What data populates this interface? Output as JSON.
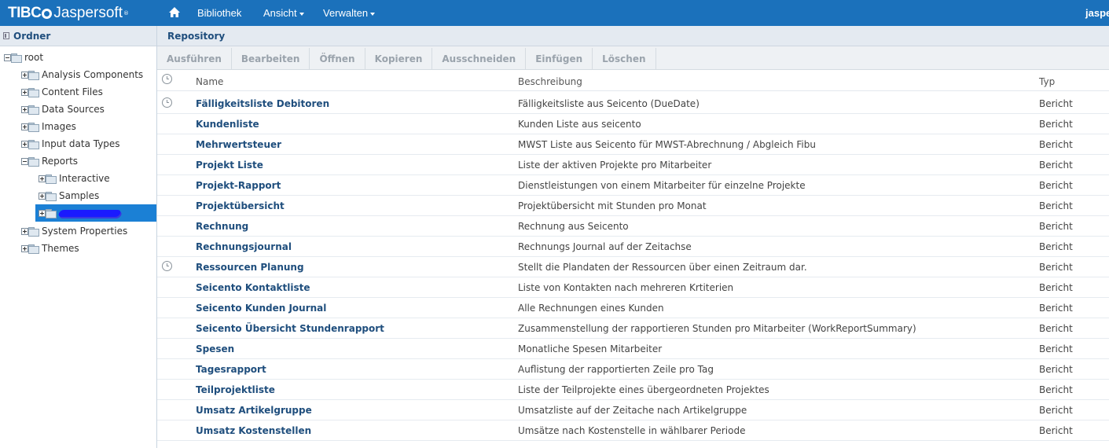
{
  "topbar": {
    "logo_brand": "TIBC",
    "logo_product": "Jaspersoft",
    "nav": [
      {
        "label": "Bibliothek",
        "dropdown": false
      },
      {
        "label": "Ansicht",
        "dropdown": true
      },
      {
        "label": "Verwalten",
        "dropdown": true
      }
    ],
    "user": "jaspe"
  },
  "left_panel": {
    "title": "Ordner",
    "tree": [
      {
        "label": "root",
        "expanded": true
      },
      {
        "label": "Analysis Components",
        "expanded": false
      },
      {
        "label": "Content Files",
        "expanded": false
      },
      {
        "label": "Data Sources",
        "expanded": false
      },
      {
        "label": "Images",
        "expanded": false
      },
      {
        "label": "Input data Types",
        "expanded": false
      },
      {
        "label": "Reports",
        "expanded": true
      },
      {
        "label": "Interactive",
        "expanded": false
      },
      {
        "label": "Samples",
        "expanded": false
      },
      {
        "label": "",
        "expanded": false,
        "selected": true,
        "redacted": true
      },
      {
        "label": "System Properties",
        "expanded": false
      },
      {
        "label": "Themes",
        "expanded": false
      }
    ]
  },
  "main": {
    "title": "Repository",
    "toolbar": [
      "Ausführen",
      "Bearbeiten",
      "Öffnen",
      "Kopieren",
      "Ausschneiden",
      "Einfügen",
      "Löschen"
    ],
    "columns": {
      "name": "Name",
      "description": "Beschreibung",
      "type": "Typ"
    },
    "rows": [
      {
        "name": "Fälligkeitsliste Debitoren",
        "description": "Fälligkeitsliste aus Seicento (DueDate)",
        "type": "Bericht",
        "scheduled": true
      },
      {
        "name": "Kundenliste",
        "description": "Kunden Liste aus seicento",
        "type": "Bericht",
        "scheduled": false
      },
      {
        "name": "Mehrwertsteuer",
        "description": "MWST Liste aus Seicento für MWST-Abrechnung / Abgleich Fibu",
        "type": "Bericht",
        "scheduled": false
      },
      {
        "name": "Projekt Liste",
        "description": "Liste der aktiven Projekte pro Mitarbeiter",
        "type": "Bericht",
        "scheduled": false
      },
      {
        "name": "Projekt-Rapport",
        "description": "Dienstleistungen von einem Mitarbeiter für einzelne Projekte",
        "type": "Bericht",
        "scheduled": false
      },
      {
        "name": "Projektübersicht",
        "description": "Projektübersicht mit Stunden pro Monat",
        "type": "Bericht",
        "scheduled": false
      },
      {
        "name": "Rechnung",
        "description": "Rechnung aus Seicento",
        "type": "Bericht",
        "scheduled": false
      },
      {
        "name": "Rechnungsjournal",
        "description": "Rechnungs Journal auf der Zeitachse",
        "type": "Bericht",
        "scheduled": false
      },
      {
        "name": "Ressourcen Planung",
        "description": "Stellt die Plandaten der Ressourcen über einen Zeitraum dar.",
        "type": "Bericht",
        "scheduled": true
      },
      {
        "name": "Seicento Kontaktliste",
        "description": "Liste von Kontakten nach mehreren Krtiterien",
        "type": "Bericht",
        "scheduled": false
      },
      {
        "name": "Seicento Kunden Journal",
        "description": "Alle Rechnungen eines Kunden",
        "type": "Bericht",
        "scheduled": false
      },
      {
        "name": "Seicento Übersicht Stundenrapport",
        "description": "Zusammenstellung der rapportieren Stunden pro Mitarbeiter (WorkReportSummary)",
        "type": "Bericht",
        "scheduled": false
      },
      {
        "name": "Spesen",
        "description": "Monatliche Spesen Mitarbeiter",
        "type": "Bericht",
        "scheduled": false
      },
      {
        "name": "Tagesrapport",
        "description": "Auflistung der rapportierten Zeile pro Tag",
        "type": "Bericht",
        "scheduled": false
      },
      {
        "name": "Teilprojektliste",
        "description": "Liste der Teilprojekte eines übergeordneten Projektes",
        "type": "Bericht",
        "scheduled": false
      },
      {
        "name": "Umsatz Artikelgruppe",
        "description": "Umsatzliste auf der Zeitache nach Artikelgruppe",
        "type": "Bericht",
        "scheduled": false
      },
      {
        "name": "Umsatz Kostenstellen",
        "description": "Umsätze nach Kostenstelle in wählbarer Periode",
        "type": "Bericht",
        "scheduled": false
      }
    ]
  },
  "colors": {
    "topbar": "#1b71bb",
    "link": "#1f4e7d",
    "selected": "#1b80d5"
  }
}
